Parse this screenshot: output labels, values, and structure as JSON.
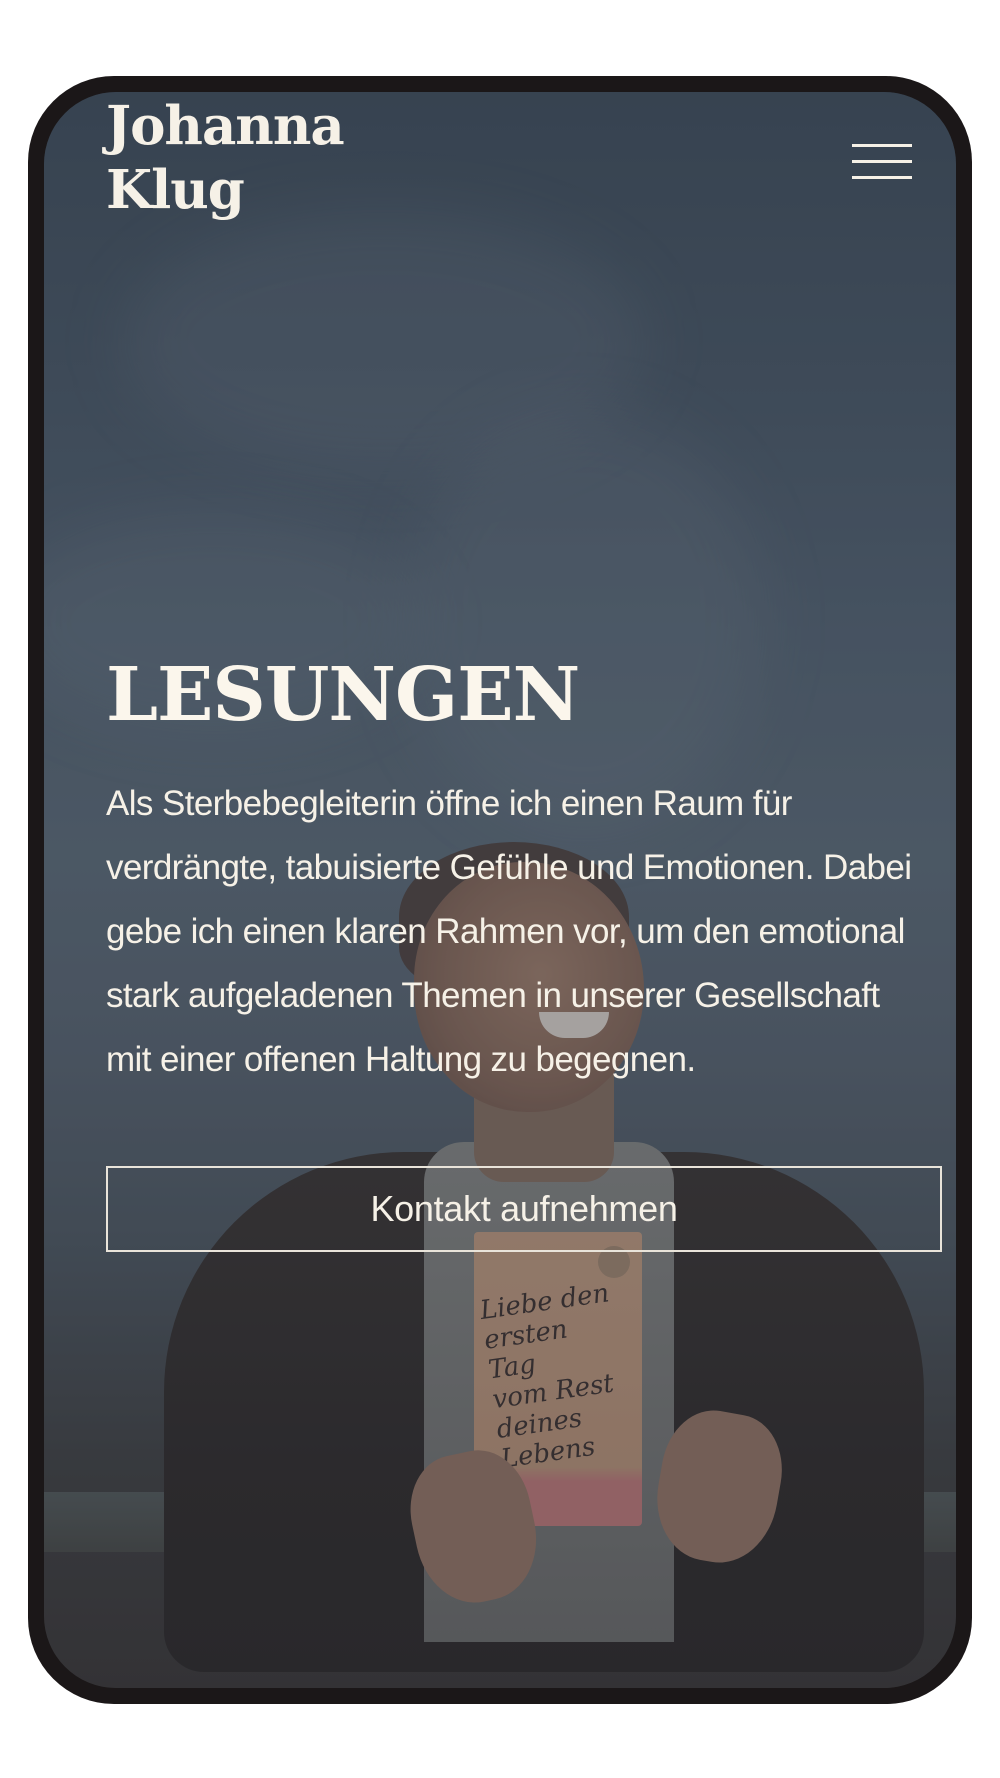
{
  "header": {
    "brand_line1": "Johanna",
    "brand_line2": "Klug",
    "menu_icon": "hamburger-menu-icon"
  },
  "hero": {
    "title": "LESUNGEN",
    "text": "Als Sterbebegleiterin öffne ich einen Raum für verdrängte, tabuisierte Gefühle und Emotionen. Dabei gebe ich einen klaren Rahmen vor, um den emotional stark aufgeladenen Themen in unserer Gesellschaft mit einer offenen Haltung zu begegnen.",
    "cta_label": "Kontakt aufnehmen"
  },
  "background_photo": {
    "book_title": "Liebe den\nersten Tag\nvom Rest\ndeines Lebens"
  },
  "colors": {
    "text": "#f6f1e7",
    "phone_frame": "#1b1718",
    "overlay": "#28323e"
  }
}
